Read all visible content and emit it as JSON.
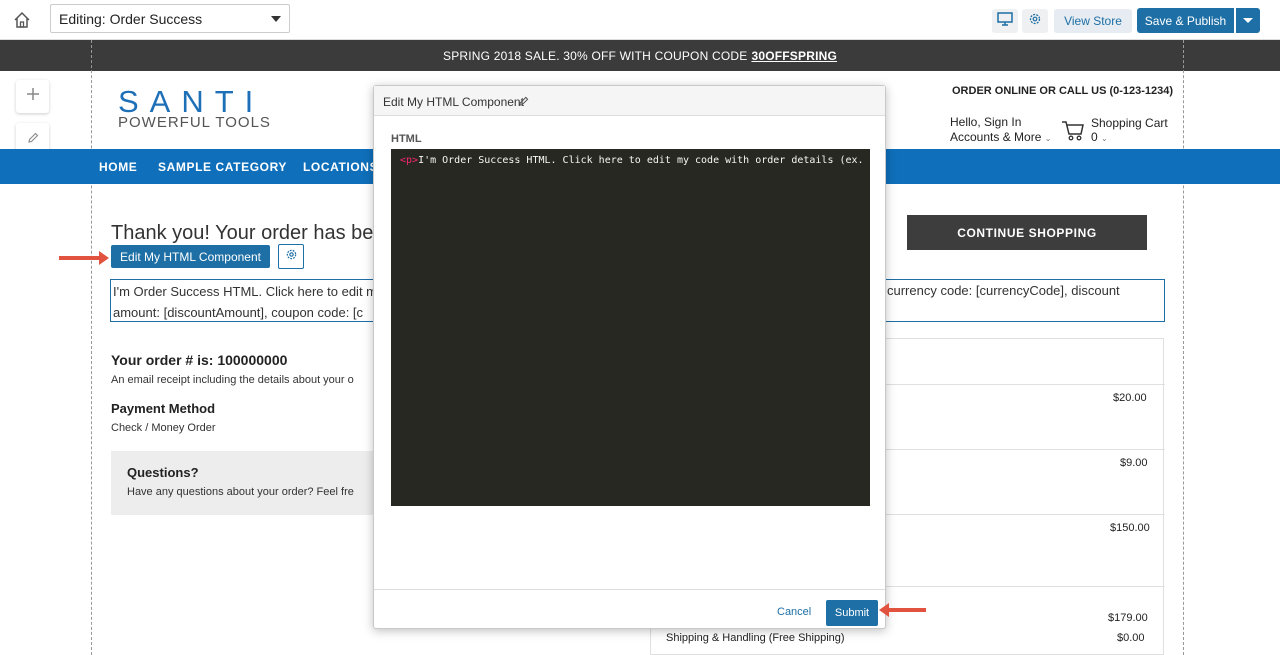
{
  "toolbar": {
    "page_select_value": "Editing: Order Success",
    "view_store_label": "View Store",
    "save_publish_label": "Save & Publish"
  },
  "promo": {
    "text": "SPRING 2018 SALE. 30% OFF WITH COUPON CODE",
    "code": "30OFFSPRING"
  },
  "store": {
    "logo_name": "SANTI",
    "logo_tagline": "POWERFUL TOOLS",
    "order_online": "ORDER ONLINE OR CALL US (0-123-1234)",
    "hello_line1": "Hello, Sign In",
    "hello_line2": "Accounts & More",
    "cart_label": "Shopping Cart",
    "cart_count": "0"
  },
  "nav": {
    "items": [
      "HOME",
      "SAMPLE CATEGORY",
      "LOCATIONS"
    ]
  },
  "page": {
    "thank_you": "Thank you! Your order has been",
    "continue_label": "CONTINUE SHOPPING",
    "edit_html_label": "Edit My HTML Component",
    "html_comp_left_1": "I'm Order Success HTML. Click here to edit m",
    "html_comp_left_2": "amount: [discountAmount], coupon code: [c",
    "html_comp_right_1": "currency code: [currencyCode], discount",
    "order_number": "Your order # is: 100000000",
    "receipt_text": "An email receipt including the details about your o",
    "payment_title": "Payment Method",
    "payment_value": "Check / Money Order",
    "questions_title": "Questions?",
    "questions_text": "Have any questions about your order? Feel fre"
  },
  "summary": {
    "prices": [
      "$20.00",
      "$9.00",
      "$150.00",
      "$179.00",
      "$0.00"
    ],
    "shipping_label": "Shipping & Handling (Free Shipping)"
  },
  "modal": {
    "title": "Edit My HTML Component",
    "field_label": "HTML",
    "code_open": "<p>",
    "code_text": "I'm Order Success HTML. Click here to edit my code with order details (ex. order",
    "cancel_label": "Cancel",
    "submit_label": "Submit"
  },
  "colors": {
    "primary": "#1d6fa5",
    "nav_bar": "#0f6fba",
    "promo_bar": "#3b3b3b",
    "editor_bg": "#272822",
    "callout_arrow": "#e2533f"
  },
  "icons": [
    "home-icon",
    "monitor-icon",
    "gear-icon",
    "chevron-down-icon",
    "plus-icon",
    "pencil-icon",
    "cart-icon"
  ]
}
